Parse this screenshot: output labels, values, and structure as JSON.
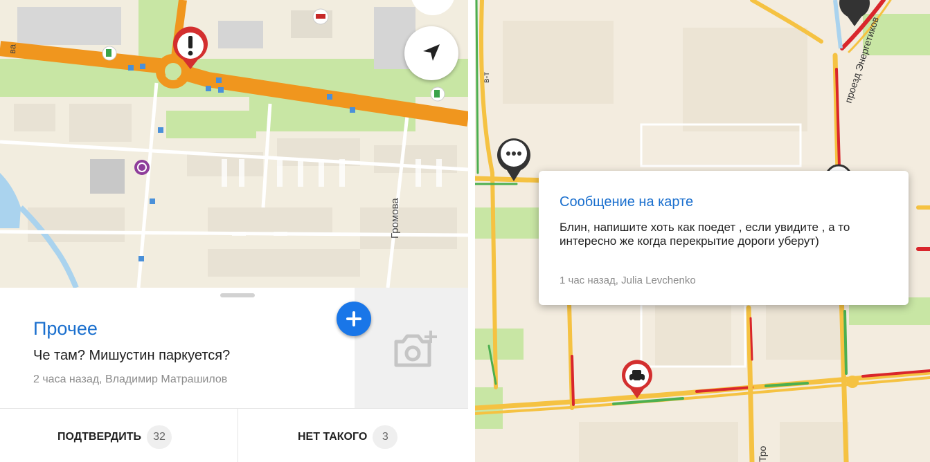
{
  "left_panel": {
    "map": {
      "street_label": "Громова",
      "street_label_edge": "ва"
    },
    "event": {
      "category": "Прочее",
      "message": "Че там? Мишустин паркуется?",
      "meta": "2 часа назад, Владимир Матрашилов"
    },
    "actions": {
      "confirm_label": "ПОДТВЕРДИТЬ",
      "confirm_count": "32",
      "deny_label": "НЕТ ТАКОГО",
      "deny_count": "3"
    }
  },
  "right_panel": {
    "map": {
      "street_label_top": "проезд Энергетиков",
      "street_label_bottom": "Тро",
      "street_label_left": "в-т"
    },
    "popup": {
      "title": "Сообщение на карте",
      "body": "Блин, напишите хоть как поедет , если увидите , а то интересно же когда перекрытие дороги уберут)",
      "meta": "1 час назад, Julia Levchenko"
    }
  },
  "icons": [
    "warning-icon",
    "locate-arrow-icon",
    "add-icon",
    "add-photo-icon",
    "chat-bubble-icon",
    "accident-icon",
    "fuel-icon",
    "bus-stop-icon"
  ],
  "colors": {
    "accent_blue": "#1976e8",
    "title_blue": "#1a6fce",
    "traffic_orange": "#f0961e",
    "traffic_yellow": "#f5c242",
    "traffic_red": "#d9262c",
    "traffic_green": "#4caf50",
    "warning_red": "#d32f2f"
  }
}
